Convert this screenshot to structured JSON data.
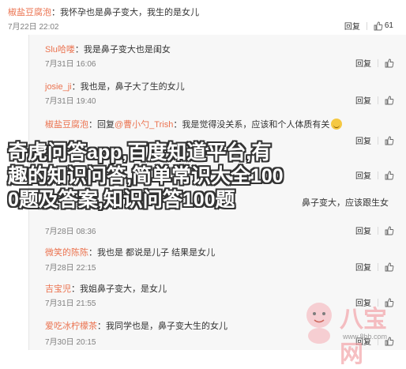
{
  "comments": [
    {
      "user": "椒盐豆腐泡",
      "sep": "：",
      "text": "我怀孕也是鼻子变大，我生的是女儿",
      "time": "7月22日 22:02",
      "reply": "回复",
      "likes": "61",
      "indent": false
    },
    {
      "user": "Slu哈喽",
      "sep": "：",
      "text": "我是鼻子变大也是闺女",
      "time": "7月31日 16:06",
      "reply": "回复",
      "likes": "",
      "indent": true
    },
    {
      "user": "josie_ji",
      "sep": "：",
      "text": "我也是，鼻子大了生的女儿",
      "time": "7月31日 19:40",
      "reply": "回复",
      "likes": "",
      "indent": true
    },
    {
      "user": "椒盐豆腐泡",
      "sep": "：回复",
      "mention": "@曹小勺_Trish",
      "text": "：我是觉得没关系，应该和个人体质有关",
      "time": "",
      "reply": "回复",
      "likes": "",
      "indent": true
    },
    {
      "user": "",
      "sep": "",
      "text": "",
      "time": "",
      "reply": "回复",
      "likes": "",
      "indent": true
    },
    {
      "user": "",
      "sep": "",
      "text": "鼻子变大，应该跟生女",
      "time": "",
      "reply": "回复",
      "likes": "",
      "indent": true
    },
    {
      "user": "",
      "sep": "",
      "text": "",
      "time": "7月28日 08:36",
      "reply": "回复",
      "likes": "",
      "indent": true
    },
    {
      "user": "微笑的陈陈",
      "sep": "：",
      "text": "我也是 都说是儿子 结果是女儿",
      "time": "7月28日 22:15",
      "reply": "回复",
      "likes": "",
      "indent": true
    },
    {
      "user": "吉宝児",
      "sep": "：",
      "text": "我姐鼻子变大，是女儿",
      "time": "7月31日 21:55",
      "reply": "回复",
      "likes": "",
      "indent": true
    },
    {
      "user": "爱吃冰柠檬茶",
      "sep": "：",
      "text": "我同学也是，鼻子变大生的女儿",
      "time": "7月30日 20:15",
      "reply": "回复",
      "likes": "",
      "indent": true
    }
  ],
  "overlay": {
    "line1": "奇虎问答app,百度知道平台,有",
    "line2": "趣的知识问答,简单常识大全100",
    "line3": "0题及答案,知识问答100题"
  },
  "watermark": {
    "text": "八宝网",
    "url": "www.8bb.com"
  },
  "colors": {
    "username": "#eb7350",
    "time": "#808080",
    "reply_bg": "#f7f7f7"
  }
}
